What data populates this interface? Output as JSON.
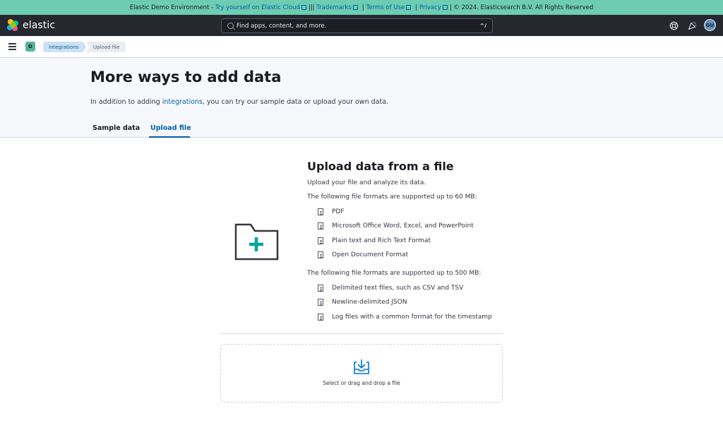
{
  "banner": {
    "lead": "Elastic Demo Environment -",
    "cloud_link": "Try yourself on Elastic Cloud",
    "pipes": "|||",
    "trademarks_link": "Trademarks",
    "terms_link": "Terms of Use",
    "privacy_link": "Privacy",
    "copyright": "| © 2024. Elasticsearch B.V. All Rights Reserved"
  },
  "header": {
    "logo_text": "elastic",
    "search_placeholder": "Find apps, content, and more.",
    "search_shortcut": "^/",
    "avatar_initials": "GU",
    "icons": [
      "help-icon",
      "newsfeed-icon"
    ]
  },
  "breadcrumbs": {
    "space_initial": "D",
    "items": [
      "Integrations",
      "Upload file"
    ]
  },
  "page": {
    "title": "More ways to add data",
    "desc_before": "In addition to adding",
    "desc_link": "integrations",
    "desc_after": ", you can try our sample data or upload your own data.",
    "tabs": [
      "Sample data",
      "Upload file"
    ],
    "selected_tab": "Upload file"
  },
  "upload": {
    "title": "Upload data from a file",
    "subtitle": "Upload your file and analyze its data.",
    "group1_heading": "The following file formats are supported up to 60 MB:",
    "group1": [
      "PDF",
      "Microsoft Office Word, Excel, and PowerPoint",
      "Plain text and Rich Text Format",
      "Open Document Format"
    ],
    "group2_heading": "The following file formats are supported up to 500 MB:",
    "group2": [
      "Delimited text files, such as CSV and TSV",
      "Newline-delimited JSON",
      "Log files with a common format for the timestamp"
    ],
    "drop_label": "Select or drag and drop a file"
  },
  "colors": {
    "banner": "#6dccb1",
    "header": "#25282f",
    "link": "#0061a6",
    "accent_green": "#00a69b"
  }
}
